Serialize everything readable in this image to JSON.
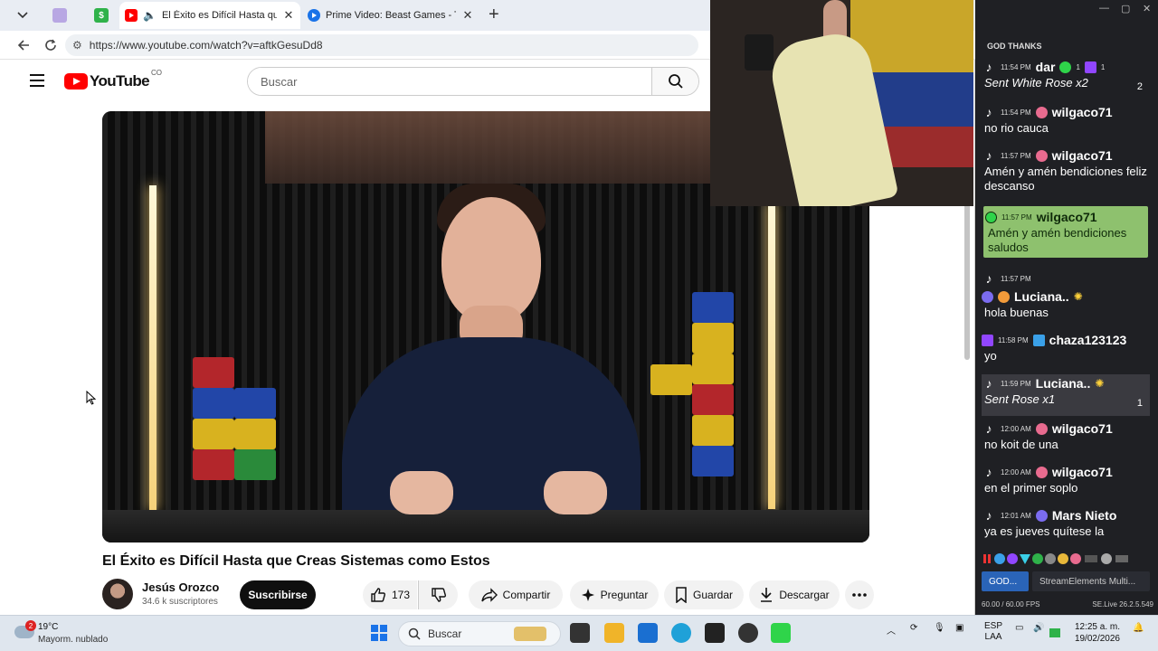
{
  "browser": {
    "tabs": [
      {
        "title": "El Éxito es Difícil Hasta que Cr",
        "active": true
      },
      {
        "title": "Prime Video: Beast Games - Temp",
        "active": false
      }
    ],
    "url": "https://www.youtube.com/watch?v=aftkGesuDd8"
  },
  "youtube": {
    "logo_text": "YouTube",
    "country_code": "CO",
    "search_placeholder": "Buscar",
    "video_title": "El Éxito es Difícil Hasta que Creas Sistemas como Estos",
    "channel_name": "Jesús Orozco",
    "subscribers": "34.6 k suscriptores",
    "subscribe_label": "Suscribirse",
    "like_count": "173",
    "share_label": "Compartir",
    "ask_label": "Preguntar",
    "save_label": "Guardar",
    "download_label": "Descargar"
  },
  "chat": {
    "header": "GOD THANKS",
    "messages": [
      {
        "time": "11:54 PM",
        "user": "dar",
        "text": "Sent White Rose x2",
        "gift": "2",
        "style": "gift"
      },
      {
        "time": "11:54 PM",
        "user": "wilgaco71",
        "text": "no rio cauca"
      },
      {
        "time": "11:57 PM",
        "user": "wilgaco71",
        "text": "Amén y amén bendiciones feliz descanso"
      },
      {
        "time": "11:57 PM",
        "user": "wilgaco71",
        "text": "Amén y amén bendiciones saludos",
        "style": "highlight"
      },
      {
        "time": "11:57 PM",
        "user": "Luciana..",
        "text": "hola buenas"
      },
      {
        "time": "11:58 PM",
        "user": "chaza123123",
        "text": "yo"
      },
      {
        "time": "11:59 PM",
        "user": "Luciana..",
        "text": "Sent Rose x1",
        "gift": "1",
        "style": "gift"
      },
      {
        "time": "12:00 AM",
        "user": "wilgaco71",
        "text": "no koit de una"
      },
      {
        "time": "12:00 AM",
        "user": "wilgaco71",
        "text": "en el primer soplo"
      },
      {
        "time": "12:01 AM",
        "user": "Mars Nieto",
        "text": "ya es jueves quítese la"
      }
    ],
    "top_counts": [
      "1",
      "1"
    ],
    "tabs": [
      "GOD...",
      "StreamElements Multi..."
    ],
    "fps": "60.00 / 60.00 FPS",
    "version": "SE.Live 26.2.5.549"
  },
  "taskbar": {
    "notification_count": "2",
    "temperature": "19°C",
    "condition": "Mayorm. nublado",
    "search_label": "Buscar",
    "language": "ESP",
    "layout": "LAA",
    "time": "12:25 a. m.",
    "date": "19/02/2026"
  }
}
